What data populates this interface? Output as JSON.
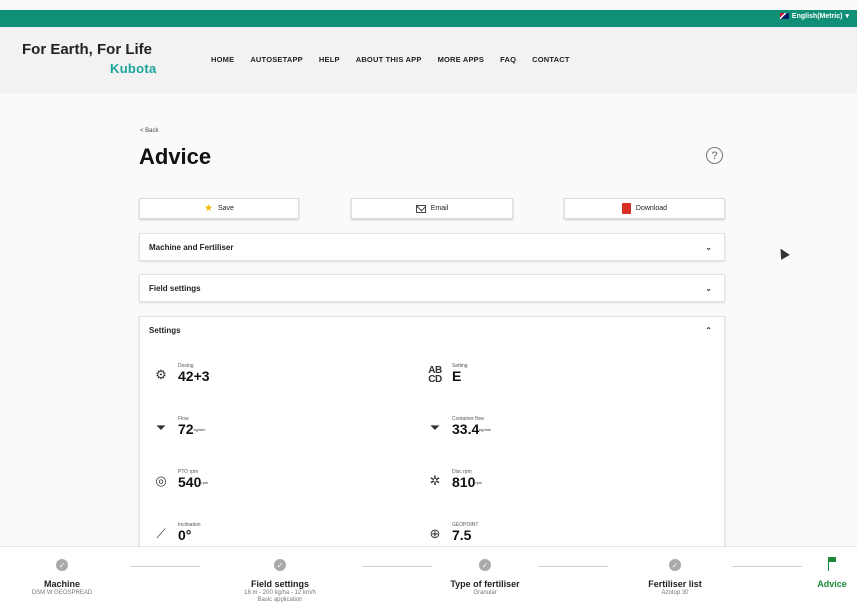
{
  "topbar": {
    "language": "English(Metric)"
  },
  "header": {
    "brand": "For Earth, For Life",
    "logo": "Kubota",
    "nav": [
      "HOME",
      "AUTOSETAPP",
      "HELP",
      "ABOUT THIS APP",
      "MORE APPS",
      "FAQ",
      "CONTACT"
    ]
  },
  "page": {
    "back": "< Back",
    "title": "Advice",
    "help": "?"
  },
  "actions": {
    "save": "Save",
    "email": "Email",
    "download": "Download"
  },
  "panels": {
    "machine": "Machine and Fertiliser",
    "field": "Field settings",
    "settings": "Settings"
  },
  "settings": [
    {
      "label": "Dosing",
      "value": "42+3",
      "unit": ""
    },
    {
      "label": "Setting",
      "value": "E",
      "unit": ""
    },
    {
      "label": "Flow",
      "value": "72",
      "unit": "kg/min"
    },
    {
      "label": "Container flow",
      "value": "33.4",
      "unit": "kg/min"
    },
    {
      "label": "PTO rpm",
      "value": "540",
      "unit": "rpm"
    },
    {
      "label": "Disc rpm",
      "value": "810",
      "unit": "rpm"
    },
    {
      "label": "Inclination",
      "value": "0°",
      "unit": ""
    },
    {
      "label": "GEOPOINT",
      "value": "7.5",
      "unit": ""
    }
  ],
  "steps": [
    {
      "title": "Machine",
      "sub": "DSM W GEOSPREAD",
      "sub2": ""
    },
    {
      "title": "Field settings",
      "sub": "18 m - 200 kg/ha - 12 km/h",
      "sub2": "Basic application"
    },
    {
      "title": "Type of fertiliser",
      "sub": "Granular",
      "sub2": ""
    },
    {
      "title": "Fertiliser list",
      "sub": "Azotop 30",
      "sub2": ""
    },
    {
      "title": "Advice",
      "sub": "",
      "sub2": ""
    }
  ],
  "colors": {
    "topbar": "#0f8f76",
    "logo": "#1aa39a",
    "active_step": "#1a8a3a"
  }
}
